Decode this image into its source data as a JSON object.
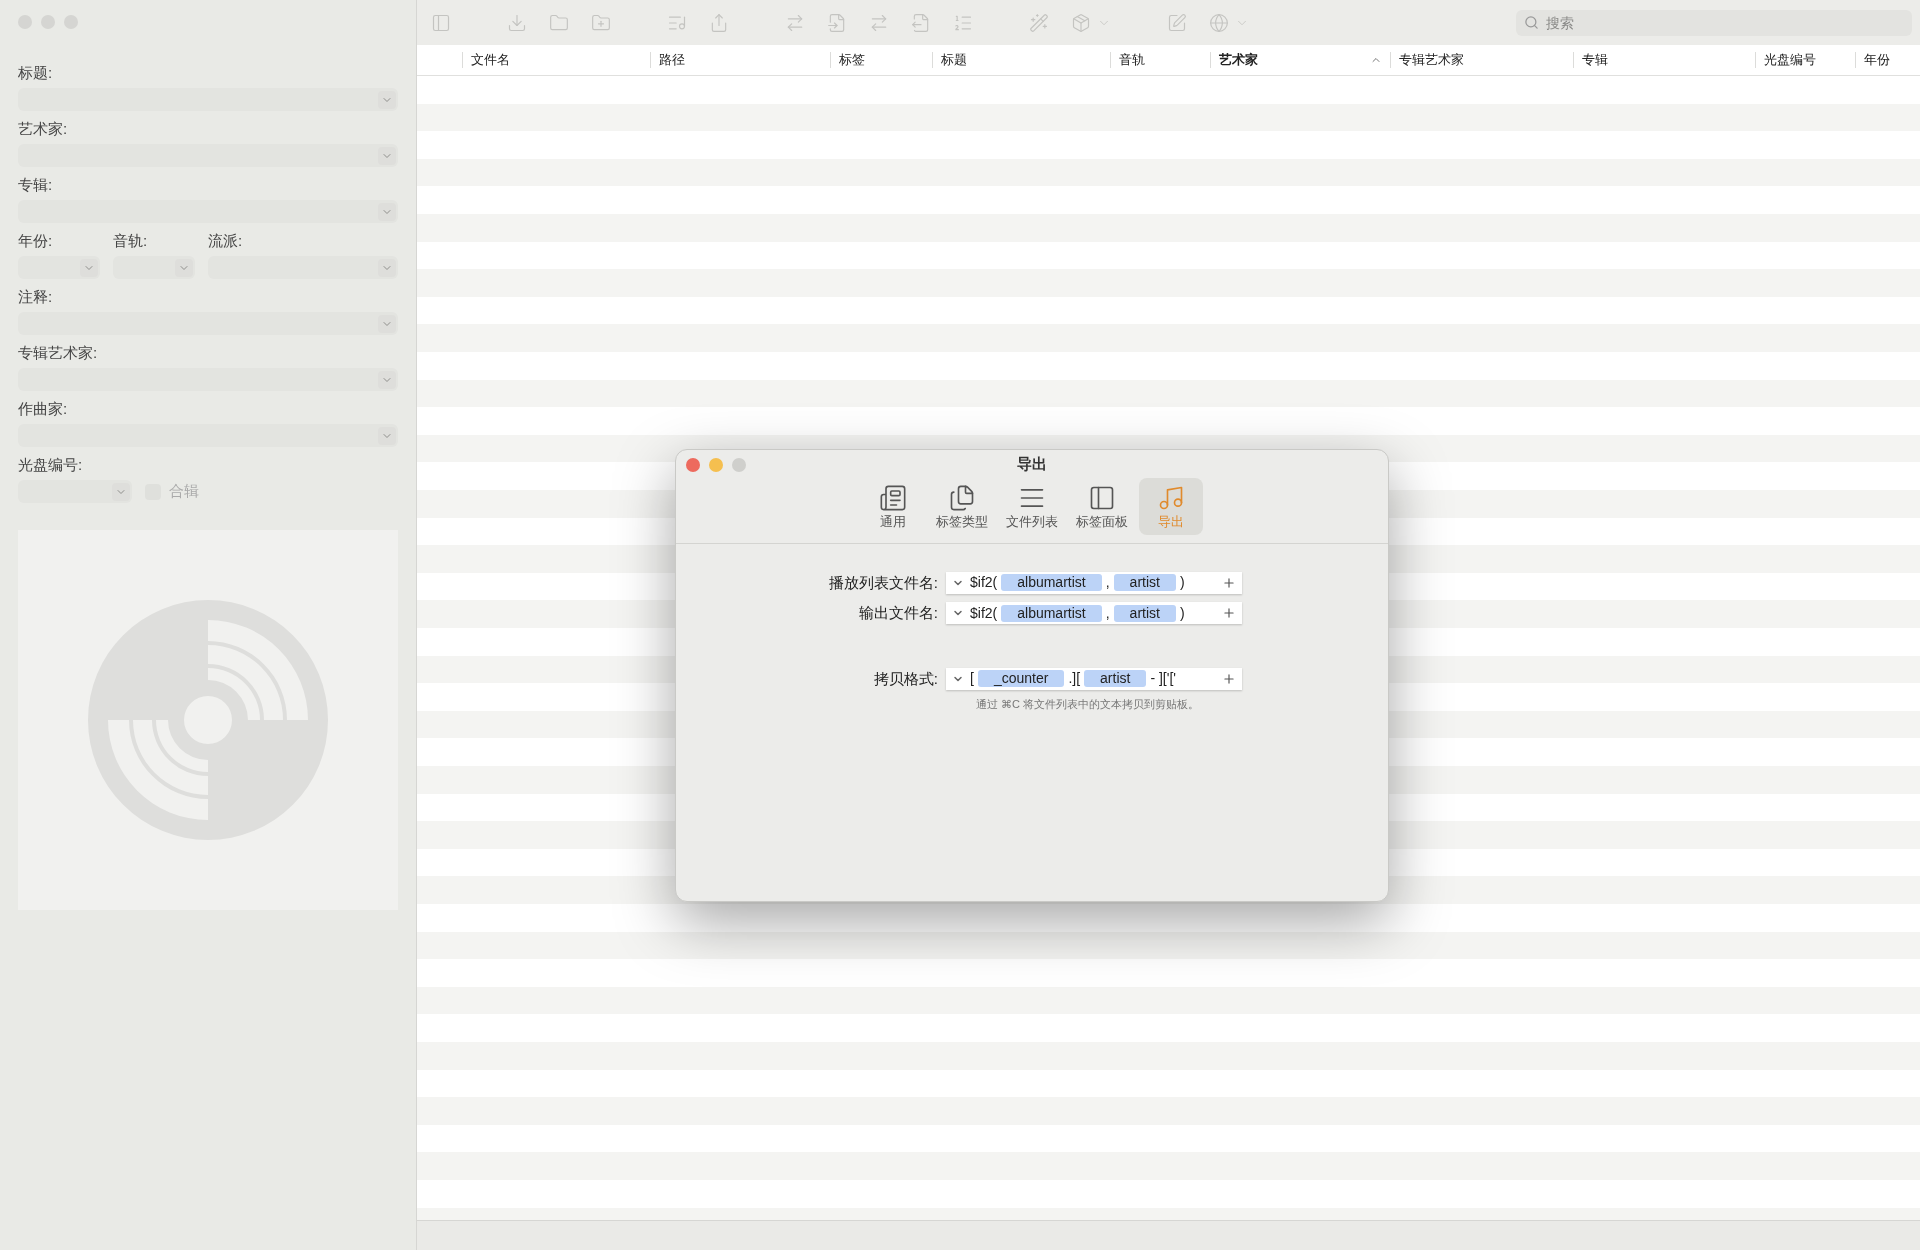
{
  "sidebar": {
    "rows": [
      {
        "fields": [
          {
            "label": "标题:"
          }
        ]
      },
      {
        "fields": [
          {
            "label": "艺术家:"
          }
        ]
      },
      {
        "fields": [
          {
            "label": "专辑:"
          }
        ]
      },
      {
        "fields": [
          {
            "label": "年份:"
          },
          {
            "label": "音轨:"
          },
          {
            "label": "流派:"
          }
        ]
      },
      {
        "fields": [
          {
            "label": "注释:"
          }
        ]
      },
      {
        "fields": [
          {
            "label": "专辑艺术家:"
          }
        ]
      },
      {
        "fields": [
          {
            "label": "作曲家:"
          }
        ]
      },
      {
        "fields": [
          {
            "label": "光盘编号:"
          }
        ],
        "checkbox": {
          "label": "合辑",
          "checked": false
        }
      }
    ]
  },
  "toolbar": {
    "search": {
      "placeholder": "搜索"
    }
  },
  "table": {
    "columns": [
      {
        "label": "文件名",
        "sorted": false
      },
      {
        "label": "路径",
        "sorted": false
      },
      {
        "label": "标签",
        "sorted": false
      },
      {
        "label": "标题",
        "sorted": false
      },
      {
        "label": "音轨",
        "sorted": false
      },
      {
        "label": "艺术家",
        "sorted": true
      },
      {
        "label": "专辑艺术家",
        "sorted": false
      },
      {
        "label": "专辑",
        "sorted": false
      },
      {
        "label": "光盘编号",
        "sorted": false
      },
      {
        "label": "年份",
        "sorted": false
      }
    ]
  },
  "dialog": {
    "title": "导出",
    "tabs": [
      {
        "label": "通用",
        "selected": false
      },
      {
        "label": "标签类型",
        "selected": false
      },
      {
        "label": "文件列表",
        "selected": false
      },
      {
        "label": "标签面板",
        "selected": false
      },
      {
        "label": "导出",
        "selected": true
      }
    ],
    "rows": [
      {
        "label": "播放列表文件名:",
        "tokens": [
          {
            "kind": "text",
            "text": "$if2("
          },
          {
            "kind": "token",
            "text": "albumartist"
          },
          {
            "kind": "text",
            "text": ","
          },
          {
            "kind": "token",
            "text": "artist"
          },
          {
            "kind": "text",
            "text": ")"
          }
        ]
      },
      {
        "label": "输出文件名:",
        "tokens": [
          {
            "kind": "text",
            "text": "$if2("
          },
          {
            "kind": "token",
            "text": "albumartist"
          },
          {
            "kind": "text",
            "text": ","
          },
          {
            "kind": "token",
            "text": "artist"
          },
          {
            "kind": "text",
            "text": ")"
          }
        ]
      },
      {
        "label": "拷贝格式:",
        "tokens": [
          {
            "kind": "text",
            "text": "["
          },
          {
            "kind": "token",
            "text": "_counter"
          },
          {
            "kind": "text",
            "text": ".]["
          },
          {
            "kind": "token",
            "text": "artist"
          },
          {
            "kind": "text",
            "text": "- ]['['"
          }
        ]
      }
    ],
    "hint": "通过 ⌘C 将文件列表中的文本拷贝到剪贴板。"
  }
}
